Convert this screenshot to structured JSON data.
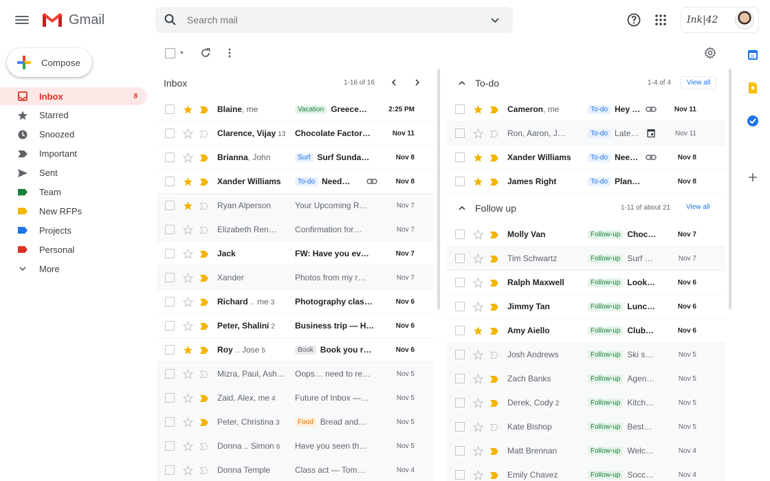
{
  "header": {
    "app_name": "Gmail",
    "search_placeholder": "Search mail",
    "account_brand": "Ink|42"
  },
  "sidebar": {
    "compose_label": "Compose",
    "items": [
      {
        "label": "Inbox",
        "icon": "inbox-icon",
        "count": "8",
        "active": true
      },
      {
        "label": "Starred",
        "icon": "star-icon"
      },
      {
        "label": "Snoozed",
        "icon": "clock-icon"
      },
      {
        "label": "Important",
        "icon": "important-icon"
      },
      {
        "label": "Sent",
        "icon": "send-icon"
      },
      {
        "label": "Team",
        "icon": "label-icon",
        "color": "#188038"
      },
      {
        "label": "New RFPs",
        "icon": "label-icon",
        "color": "#f4b400"
      },
      {
        "label": "Projects",
        "icon": "label-icon",
        "color": "#1a73e8"
      },
      {
        "label": "Personal",
        "icon": "label-icon",
        "color": "#d93025"
      },
      {
        "label": "More",
        "icon": "chevron-down-icon"
      }
    ]
  },
  "inbox": {
    "title": "Inbox",
    "range": "1-16 of 16",
    "rows": [
      {
        "sender": "Blaine",
        "sender_secondary": ", me",
        "chip": "Vacation",
        "chip_style": "green",
        "subject": "Greece…",
        "date": "2:25 PM",
        "starred": true,
        "important": true,
        "unread": true
      },
      {
        "sender": "Clarence, Vijay",
        "count": "13",
        "subject": "Chocolate Factor…",
        "date": "Nov 11",
        "starred": false,
        "important": false,
        "unread": true
      },
      {
        "sender": "Brianna",
        "sender_secondary": ", John",
        "chip": "Surf",
        "chip_style": "blue",
        "subject": "Surf Sunda…",
        "date": "Nov 8",
        "starred": false,
        "important": true,
        "unread": true
      },
      {
        "sender": "Xander Williams",
        "chip": "To-do",
        "chip_style": "blue",
        "subject": "Need…",
        "date": "Nov 8",
        "starred": true,
        "important": true,
        "unread": true,
        "attachment": "link-icon"
      },
      {
        "sender": "Ryan Alperson",
        "subject": "Your Upcoming R…",
        "date": "Nov 7",
        "starred": true,
        "important": false,
        "unread": false
      },
      {
        "sender": "Elizabeth Ren…",
        "subject": "Confirmation for…",
        "date": "Nov 7",
        "starred": false,
        "important": false,
        "unread": false
      },
      {
        "sender": "Jack",
        "subject": "FW: Have you ev…",
        "date": "Nov 7",
        "starred": false,
        "important": true,
        "unread": true
      },
      {
        "sender": "Xander",
        "subject": "Photos from my r…",
        "date": "Nov 7",
        "starred": false,
        "important": true,
        "unread": false
      },
      {
        "sender": "Richard",
        "sender_secondary": " .. me",
        "count": "3",
        "subject": "Photography clas…",
        "date": "Nov 6",
        "starred": false,
        "important": true,
        "unread": true
      },
      {
        "sender": "Peter, Shalini",
        "count": "2",
        "subject": "Business trip — H…",
        "date": "Nov 6",
        "starred": false,
        "important": true,
        "unread": true
      },
      {
        "sender": "Roy",
        "sender_secondary": " .. Jose",
        "count": "5",
        "chip": "Book",
        "chip_style": "grey",
        "subject": "Book you r…",
        "date": "Nov 6",
        "starred": true,
        "important": true,
        "unread": true
      },
      {
        "sender": "Mizra, Paul, Ash…",
        "subject": "Oops… need to re…",
        "date": "Nov 5",
        "starred": false,
        "important": false,
        "unread": false
      },
      {
        "sender": "Zaid, Alex, me",
        "count": "4",
        "subject": "Future of Inbox —…",
        "date": "Nov 5",
        "starred": false,
        "important": true,
        "unread": false
      },
      {
        "sender": "Peter, Christina",
        "count": "3",
        "chip": "Food",
        "chip_style": "orange",
        "subject": "Bread and…",
        "date": "Nov 5",
        "starred": false,
        "important": true,
        "unread": false
      },
      {
        "sender": "Donna .. Simon",
        "count": "6",
        "subject": "Have you seen th…",
        "date": "Nov 5",
        "starred": false,
        "important": false,
        "unread": false
      },
      {
        "sender": "Donna Temple",
        "subject": "Class act — Tom…",
        "date": "Nov 4",
        "starred": false,
        "important": false,
        "unread": false
      }
    ]
  },
  "todo": {
    "title": "To-do",
    "range": "1-4 of 4",
    "view_all": "View all",
    "rows": [
      {
        "sender": "Cameron",
        "sender_secondary": ", me",
        "chip": "To-do",
        "subject": "Hey t…",
        "date": "Nov 11",
        "starred": true,
        "important": true,
        "unread": true,
        "attachment": "link-icon"
      },
      {
        "sender": "Ron, Aaron, J…",
        "chip": "To-do",
        "subject": "Late…",
        "date": "Nov 11",
        "starred": false,
        "important": false,
        "unread": false,
        "attachment": "calendar-icon"
      },
      {
        "sender": "Xander Williams",
        "chip": "To-do",
        "subject": "Need…",
        "date": "Nov 8",
        "starred": true,
        "important": true,
        "unread": true,
        "attachment": "link-icon"
      },
      {
        "sender": "James Right",
        "chip": "To-do",
        "subject": "Plan…",
        "date": "Nov 8",
        "starred": true,
        "important": true,
        "unread": true
      }
    ]
  },
  "followup": {
    "title": "Follow up",
    "range": "1-11 of about 21",
    "view_all": "View all",
    "rows": [
      {
        "sender": "Molly Van",
        "chip": "Follow-up",
        "subject": "Choco…",
        "date": "Nov 7",
        "starred": false,
        "important": true,
        "unread": true
      },
      {
        "sender": "Tim Schwartz",
        "chip": "Follow-up",
        "subject": "Surf S…",
        "date": "Nov 7",
        "starred": false,
        "important": true,
        "unread": false
      },
      {
        "sender": "Ralph Maxwell",
        "chip": "Follow-up",
        "subject": "Looki…",
        "date": "Nov 6",
        "starred": false,
        "important": true,
        "unread": true
      },
      {
        "sender": "Jimmy Tan",
        "chip": "Follow-up",
        "subject": "Lunch…",
        "date": "Nov 6",
        "starred": false,
        "important": true,
        "unread": true
      },
      {
        "sender": "Amy Aiello",
        "chip": "Follow-up",
        "subject": "Club…",
        "date": "Nov 6",
        "starred": true,
        "important": true,
        "unread": true
      },
      {
        "sender": "Josh Andrews",
        "chip": "Follow-up",
        "subject": "Ski se…",
        "date": "Nov 5",
        "starred": false,
        "important": false,
        "unread": false
      },
      {
        "sender": "Zach Banks",
        "chip": "Follow-up",
        "subject": "Agend…",
        "date": "Nov 5",
        "starred": false,
        "important": true,
        "unread": false
      },
      {
        "sender": "Derek, Cody",
        "count": "2",
        "chip": "Follow-up",
        "subject": "Kitche…",
        "date": "Nov 5",
        "starred": false,
        "important": true,
        "unread": false
      },
      {
        "sender": "Kate Bishop",
        "chip": "Follow-up",
        "subject": "Best…",
        "date": "Nov 5",
        "starred": false,
        "important": false,
        "unread": false
      },
      {
        "sender": "Matt Brennan",
        "chip": "Follow-up",
        "subject": "Welco…",
        "date": "Nov 4",
        "starred": false,
        "important": true,
        "unread": false
      },
      {
        "sender": "Emily Chavez",
        "chip": "Follow-up",
        "subject": "Socce…",
        "date": "Nov 4",
        "starred": false,
        "important": true,
        "unread": false
      }
    ]
  },
  "colors": {
    "brand_red": "#d93025",
    "star_yellow": "#f4b400",
    "link_blue": "#1a73e8",
    "followup_green": "#188038"
  }
}
